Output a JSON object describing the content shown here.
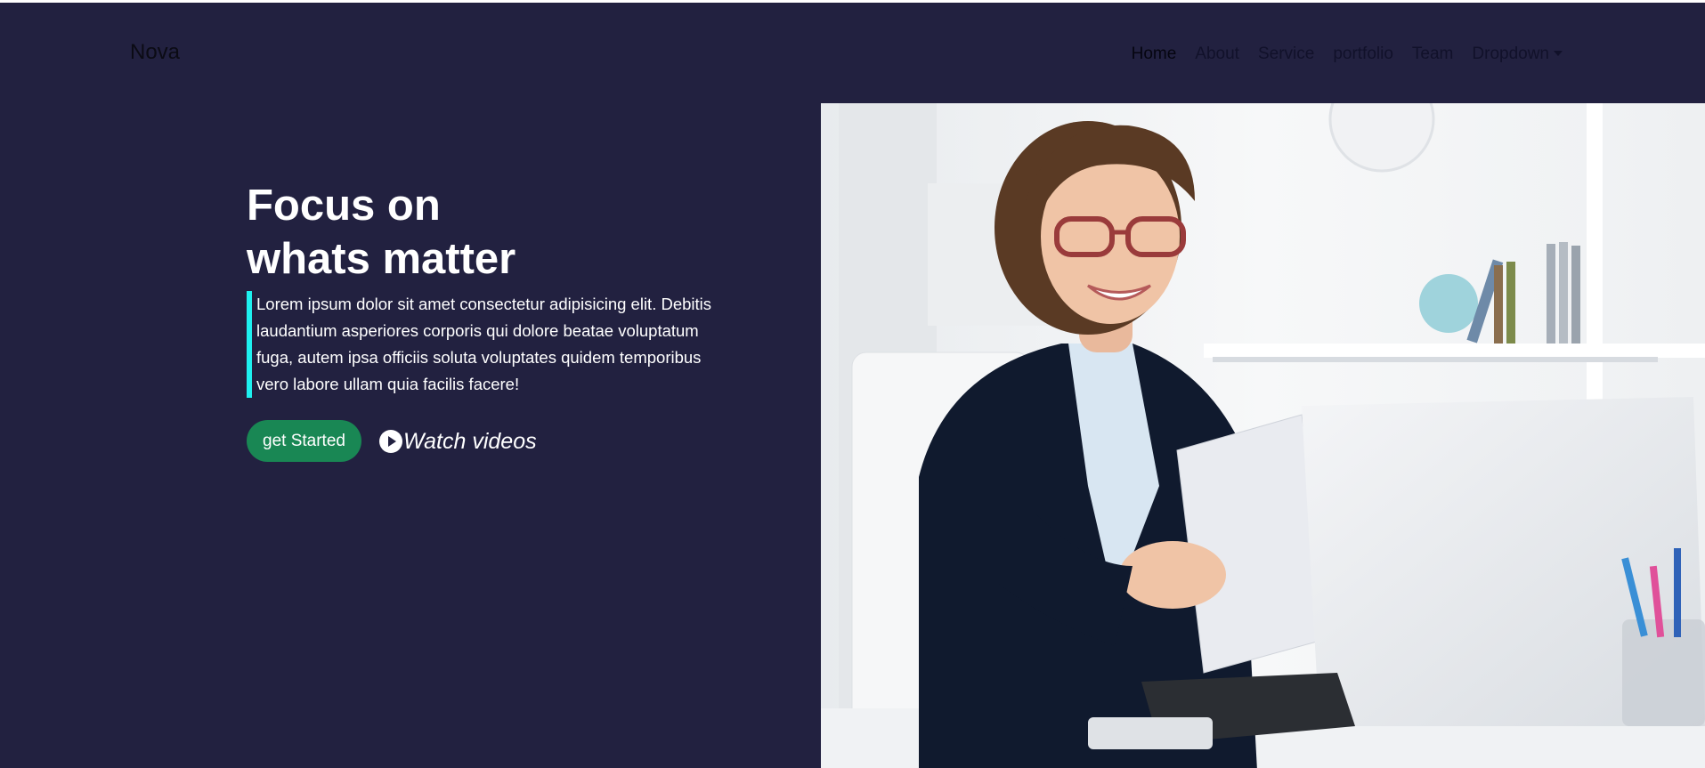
{
  "navbar": {
    "brand": "Nova",
    "items": [
      {
        "label": "Home",
        "active": true
      },
      {
        "label": "About"
      },
      {
        "label": "Service"
      },
      {
        "label": "portfolio"
      },
      {
        "label": "Team"
      },
      {
        "label": "Dropdown",
        "has_caret": true
      }
    ]
  },
  "hero": {
    "headline_line1": "Focus on",
    "headline_line2": "whats matter",
    "lead": "Lorem ipsum dolor sit amet consectetur adipisicing elit. Debitis laudantium asperiores corporis qui dolore beatae voluptatum fuga, autem ipsa officiis soluta voluptates quidem temporibus vero labore ullam quia facilis facere!",
    "primary_button": "get Started",
    "video_link": "Watch videos",
    "play_icon": "play-circle-icon"
  },
  "colors": {
    "background": "#222140",
    "accent_bar": "#1ef0f0",
    "primary_button": "#198754",
    "text": "#ffffff"
  }
}
